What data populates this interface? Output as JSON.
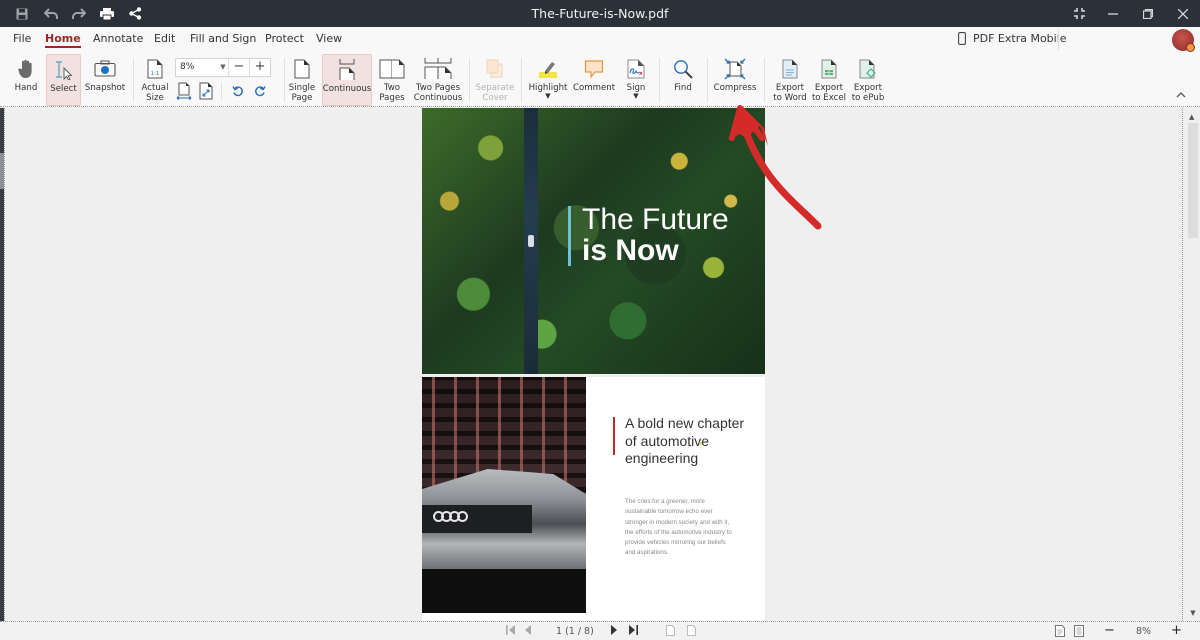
{
  "window": {
    "title": "The-Future-is-Now.pdf",
    "quick_access": [
      "save-icon",
      "undo-icon",
      "redo-icon",
      "print-icon",
      "share-icon"
    ],
    "controls": [
      "fullscreen-icon",
      "minimize-icon",
      "restore-icon",
      "close-icon"
    ]
  },
  "menu": {
    "items": [
      {
        "label": "File"
      },
      {
        "label": "Home",
        "active": true
      },
      {
        "label": "Annotate"
      },
      {
        "label": "Edit"
      },
      {
        "label": "Fill and Sign"
      },
      {
        "label": "Protect"
      },
      {
        "label": "View"
      }
    ],
    "mobile_label": "PDF Extra Mobile"
  },
  "ribbon": {
    "hand": "Hand",
    "select": "Select",
    "snapshot": "Snapshot",
    "actual_size_1": "Actual",
    "actual_size_2": "Size",
    "zoom_value": "8%",
    "zoom_minus": "−",
    "zoom_plus": "+",
    "single_page_1": "Single",
    "single_page_2": "Page",
    "continuous": "Continuous",
    "two_pages_1": "Two",
    "two_pages_2": "Pages",
    "two_pages_cont_1": "Two Pages",
    "two_pages_cont_2": "Continuous",
    "separate_cover_1": "Separate",
    "separate_cover_2": "Cover",
    "highlight": "Highlight",
    "comment": "Comment",
    "sign": "Sign",
    "find": "Find",
    "compress": "Compress",
    "export_word_1": "Export",
    "export_word_2": "to Word",
    "export_excel_1": "Export",
    "export_excel_2": "to Excel",
    "export_epub_1": "Export",
    "export_epub_2": "to ePub",
    "accent_color": "#a1262a",
    "selected_bg": "#f1e1e0"
  },
  "document": {
    "page1": {
      "title_line1": "The Future",
      "title_line2": "is Now",
      "accent_color": "#6bc3d6"
    },
    "page2": {
      "heading": "A bold new chapter of automotive engineering",
      "body": "The cries for a greener, more sustainable tomorrow echo ever stronger in modern society and with it, the efforts of the automotive industry to provide vehicles mirroring our beliefs and aspirations.",
      "accent_color": "#c9262c"
    }
  },
  "statusbar": {
    "page_indicator": "1 (1 / 8)",
    "zoom": "8%"
  },
  "annotation": {
    "arrow_color": "#d42a2a",
    "points_to": "Compress"
  }
}
